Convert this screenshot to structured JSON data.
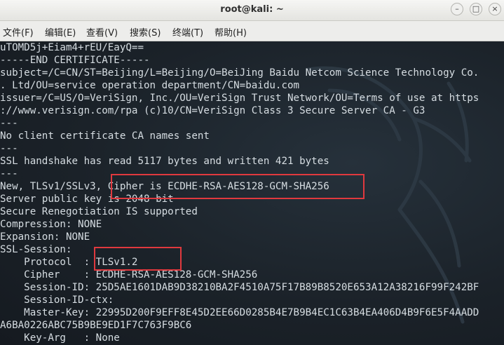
{
  "window": {
    "title": "root@kali: ~",
    "minimize_glyph": "–",
    "maximize_glyph": "□",
    "close_glyph": "×"
  },
  "menu": [
    "文件(F)",
    "编辑(E)",
    "查看(V)",
    "搜索(S)",
    "终端(T)",
    "帮助(H)"
  ],
  "terminal": {
    "lines": [
      "uTOMD5j+Eiam4+rEU/EayQ==",
      "-----END CERTIFICATE-----",
      "subject=/C=CN/ST=Beijing/L=Beijing/O=BeiJing Baidu Netcom Science Technology Co.",
      ". Ltd/OU=service operation department/CN=baidu.com",
      "issuer=/C=US/O=VeriSign, Inc./OU=VeriSign Trust Network/OU=Terms of use at https",
      "://www.verisign.com/rpa (c)10/CN=VeriSign Class 3 Secure Server CA - G3",
      "---",
      "No client certificate CA names sent",
      "---",
      "SSL handshake has read 5117 bytes and written 421 bytes",
      "---",
      "New, TLSv1/SSLv3, Cipher is ECDHE-RSA-AES128-GCM-SHA256",
      "Server public key is 2048 bit",
      "Secure Renegotiation IS supported",
      "Compression: NONE",
      "Expansion: NONE",
      "SSL-Session:",
      "    Protocol  : TLSv1.2",
      "    Cipher    : ECDHE-RSA-AES128-GCM-SHA256",
      "    Session-ID: 25D5AE1601DAB9D38210BA2F4510A75F17B89B8520E653A12A38216F99F242BF",
      "    Session-ID-ctx:",
      "    Master-Key: 22995D200F9EFF8E45D2EE66D0285B4E7B9B4EC1C63B4EA406D4B9F6E5F4AADD",
      "A6BA0226ABC75B9BE9ED1F7C763F9BC6",
      "    Key-Arg   : None"
    ]
  },
  "colors": {
    "highlight_box": "#e0393e",
    "terminal_text": "#d6dde2",
    "terminal_bg": "#1a2027"
  }
}
